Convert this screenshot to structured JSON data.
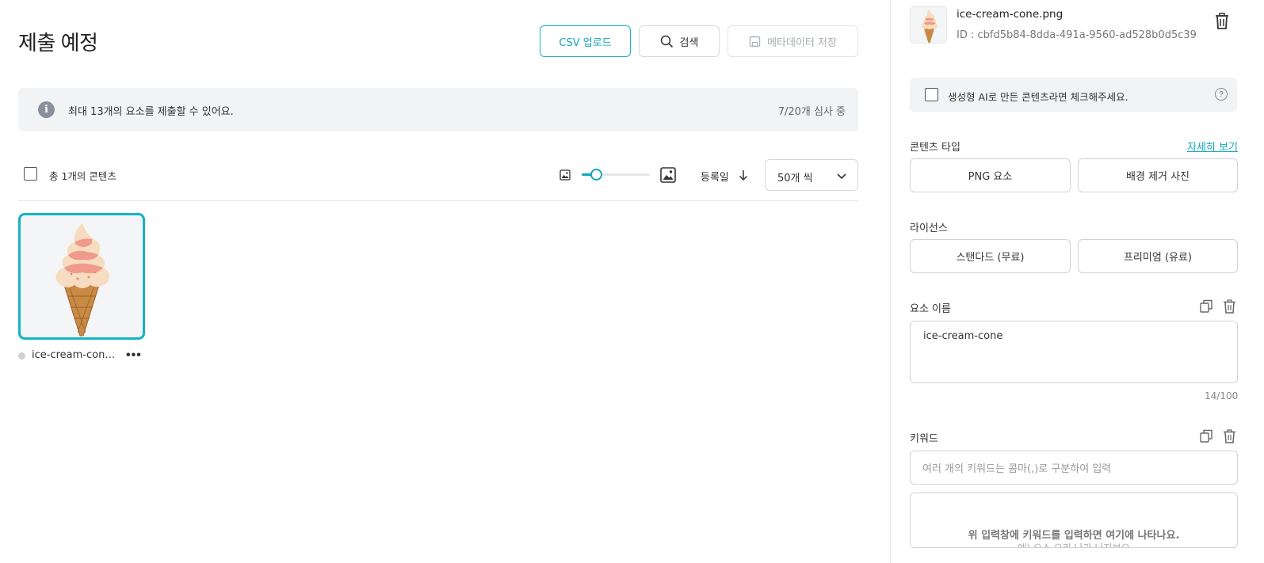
{
  "page": {
    "title": "제출 예정"
  },
  "toolbar": {
    "csv_upload_label": "CSV 업로드",
    "search_label": "검색",
    "save_metadata_label": "메타데이터 저장"
  },
  "notice": {
    "text": "최대 13개의 요소를 제출할 수 있어요.",
    "status": "7/20개 심사 중"
  },
  "list_controls": {
    "total_label": "총 1개의 콘텐츠",
    "sort_label": "등록일",
    "per_page_label": "50개 씩",
    "thumbnail_size": 0.2
  },
  "items": [
    {
      "name": "ice-cream-cone.png",
      "display_name": "ice-cream-cone..."
    }
  ],
  "detail": {
    "file_name": "ice-cream-cone.png",
    "file_id": "ID : cbfd5b84-8dda-491a-9560-ad528b0d5c39",
    "ai_checkbox_label": "생성형 AI로 만든 콘텐츠라면 체크해주세요.",
    "content_type_label": "콘텐츠 타입",
    "detail_link": "자세히 보기",
    "content_types": [
      "PNG 요소",
      "배경 제거 사진"
    ],
    "license_label": "라이선스",
    "licenses": [
      "스탠다드 (무료)",
      "프리미엄 (유료)"
    ],
    "element_name_label": "요소 이름",
    "element_name_value": "ice-cream-cone",
    "element_name_counter": "14/100",
    "keywords_label": "키워드",
    "keywords_placeholder": "여러 개의 키워드는 콤마(,)로 구분하여 입력",
    "keywords_hint": "위 입력창에 키워드를 입력하면 여기에 나타나요.",
    "keywords_example": "예) 요소 오리 나가 나지부오"
  },
  "colors": {
    "accent": "#14a7b8",
    "notice_bg": "#f2f3f5"
  }
}
